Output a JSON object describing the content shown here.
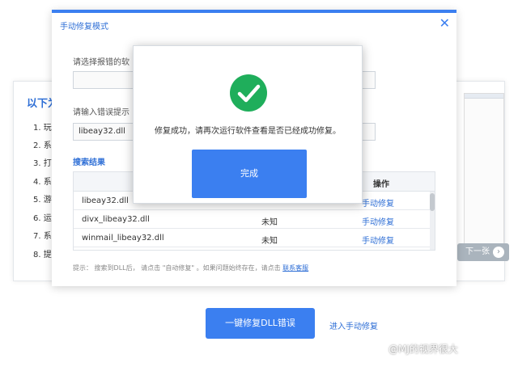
{
  "background": {
    "title": "以下为",
    "steps": [
      "1. 玩",
      "2. 系",
      "3. 打",
      "4. 系",
      "5. 游",
      "6. 运",
      "7. 系",
      "8. 提"
    ],
    "next_button": "下一张",
    "next_icon": "chevron-right-icon"
  },
  "dialog": {
    "title": "手动修复模式",
    "close_icon": "close-icon",
    "label_software": "请选择报错的软",
    "software_value": "",
    "label_error": "请输入错误提示",
    "error_value": "libeay32.dll",
    "results_title": "搜索结果",
    "table": {
      "header_action": "操作",
      "rows": [
        {
          "name": "libeay32.dll",
          "status": "",
          "action": "手动修复"
        },
        {
          "name": "divx_libeay32.dll",
          "status": "未知",
          "action": "手动修复"
        },
        {
          "name": "winmail_libeay32.dll",
          "status": "未知",
          "action": "手动修复"
        }
      ]
    },
    "hint_text": "提示： 搜索到DLL后， 请点击 \"自动修复\" 。如果问题始终存在，请点击 ",
    "hint_link": "联系客服"
  },
  "popup": {
    "icon": "success-check-icon",
    "message": "修复成功，请再次运行软件查看是否已经成功修复。",
    "done_label": "完成"
  },
  "actions": {
    "fix_button": "一键修复DLL错误",
    "manual_link": "进入手动修复"
  },
  "watermark": "@MJ的视界很大",
  "colors": {
    "accent": "#3b7ff0",
    "success": "#1fae5b",
    "link": "#2f6fd6"
  }
}
